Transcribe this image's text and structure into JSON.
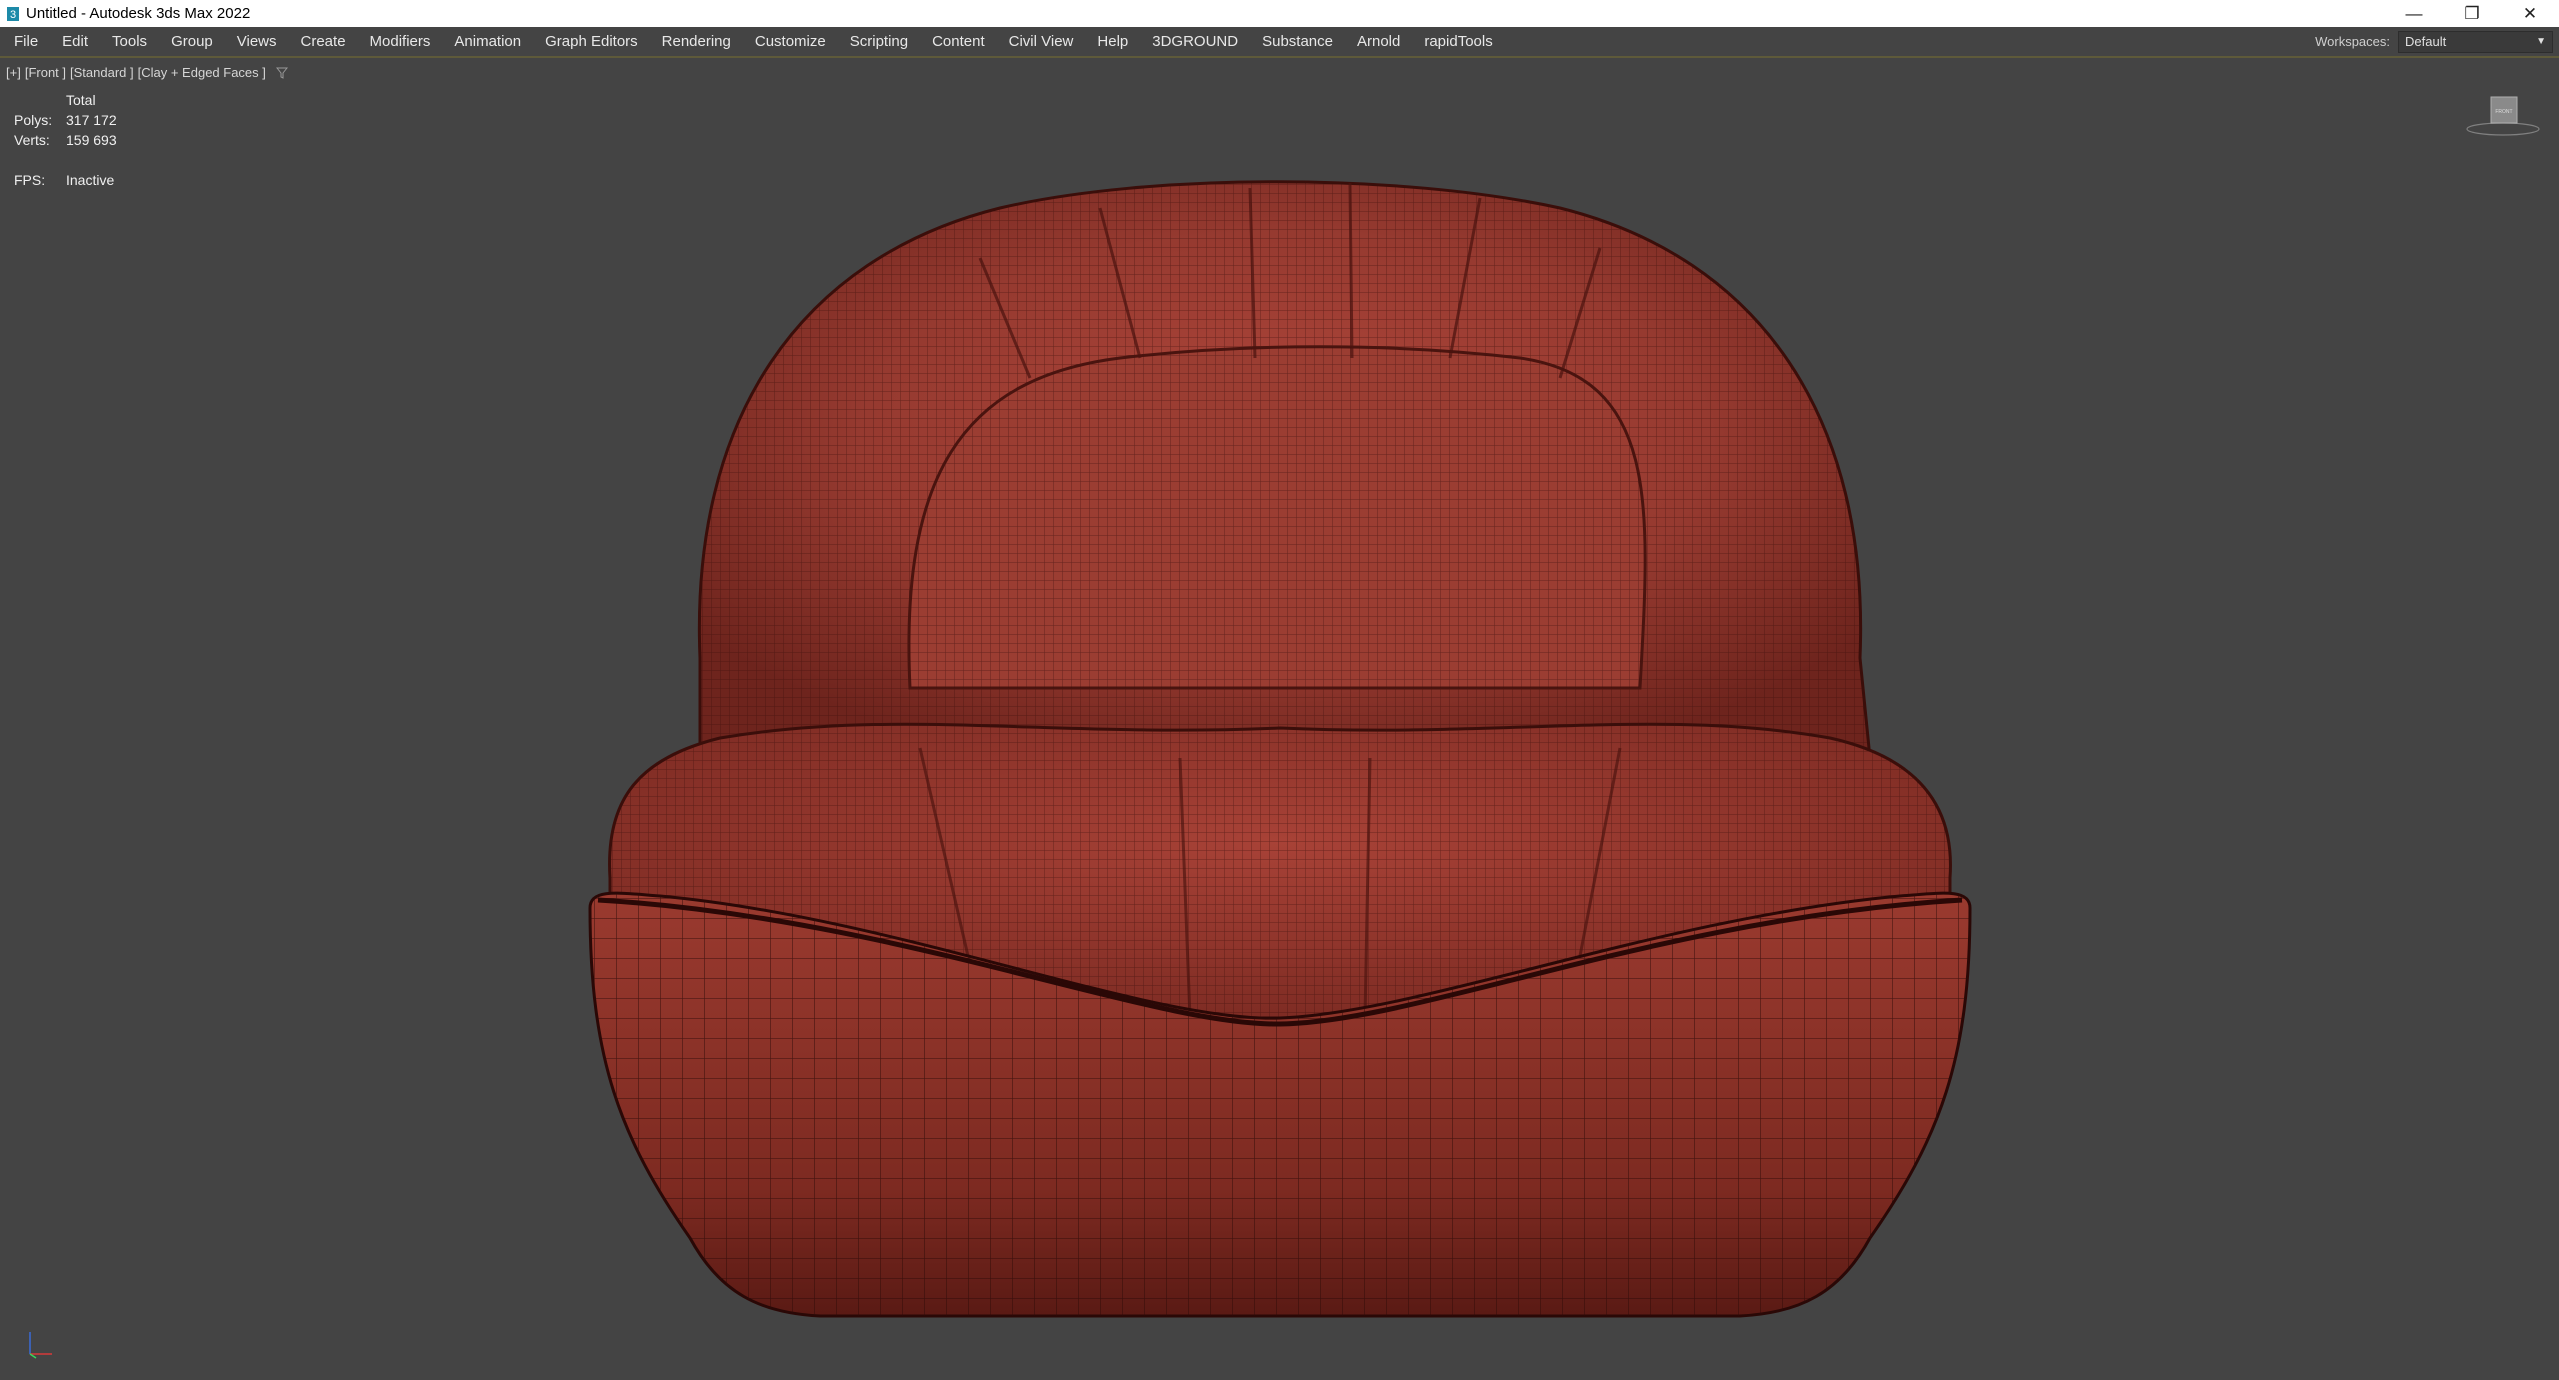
{
  "window": {
    "title": "Untitled - Autodesk 3ds Max 2022",
    "controls": {
      "minimize": "—",
      "restore": "❐",
      "close": "✕"
    }
  },
  "menubar": {
    "items": [
      "File",
      "Edit",
      "Tools",
      "Group",
      "Views",
      "Create",
      "Modifiers",
      "Animation",
      "Graph Editors",
      "Rendering",
      "Customize",
      "Scripting",
      "Content",
      "Civil View",
      "Help",
      "3DGROUND",
      "Substance",
      "Arnold",
      "rapidTools"
    ],
    "workspaces_label": "Workspaces:",
    "workspaces_value": "Default"
  },
  "viewport": {
    "label_parts": [
      "[+]",
      "[Front ]",
      "[Standard ]",
      "[Clay + Edged Faces ]"
    ],
    "stats": {
      "header": "Total",
      "polys_label": "Polys:",
      "polys_value": "317 172",
      "verts_label": "Verts:",
      "verts_value": "159 693",
      "fps_label": "FPS:",
      "fps_value": "Inactive"
    },
    "viewcube_face": "FRONT",
    "model_color": "#8a2f26",
    "background_color": "#444444"
  }
}
